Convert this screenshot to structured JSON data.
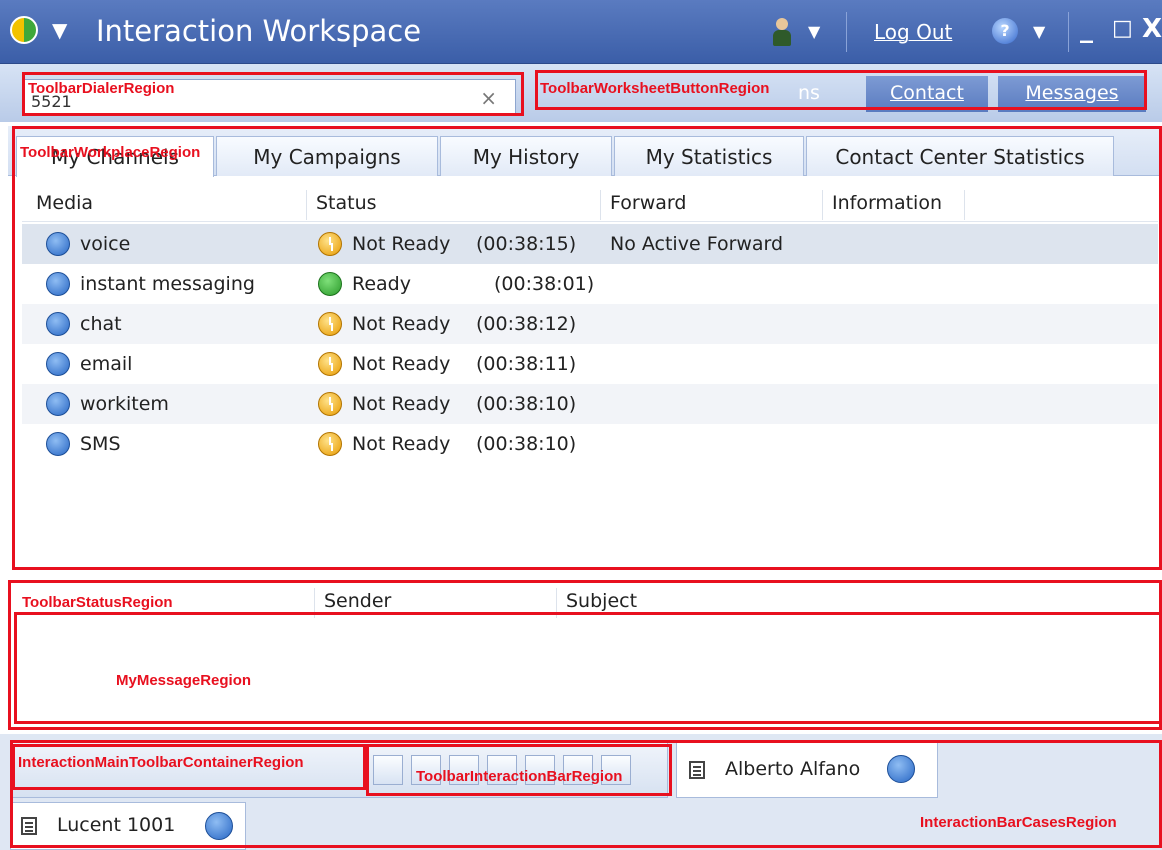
{
  "window": {
    "title": "Interaction Workspace",
    "logout_label": "Log Out",
    "help_glyph": "?",
    "minimize_glyph": "_",
    "maximize_glyph": "□",
    "close_glyph": "X"
  },
  "toolbar": {
    "dialer_value": "5521",
    "clear_glyph": "×",
    "interactions_label": "ns",
    "contact_label": "Contact",
    "messages_label": "Messages"
  },
  "tabs": [
    {
      "label": "My Channels"
    },
    {
      "label": "My Campaigns"
    },
    {
      "label": "My History"
    },
    {
      "label": "My Statistics"
    },
    {
      "label": "Contact Center Statistics"
    }
  ],
  "channels": {
    "columns": [
      "Media",
      "Status",
      "Forward",
      "Information"
    ],
    "rows": [
      {
        "media": "voice",
        "status": "Not Ready",
        "time": "(00:38:15)",
        "forward": "No Active Forward",
        "state": "notready"
      },
      {
        "media": "instant messaging",
        "status": "Ready",
        "time": "(00:38:01)",
        "forward": "",
        "state": "ready"
      },
      {
        "media": "chat",
        "status": "Not Ready",
        "time": "(00:38:12)",
        "forward": "",
        "state": "notready"
      },
      {
        "media": "email",
        "status": "Not Ready",
        "time": "(00:38:11)",
        "forward": "",
        "state": "notready"
      },
      {
        "media": "workitem",
        "status": "Not Ready",
        "time": "(00:38:10)",
        "forward": "",
        "state": "notready"
      },
      {
        "media": "SMS",
        "status": "Not Ready",
        "time": "(00:38:10)",
        "forward": "",
        "state": "notready"
      }
    ]
  },
  "messages": {
    "columns": [
      "Sender",
      "Subject"
    ]
  },
  "cases": [
    {
      "name": "Alberto Alfano"
    },
    {
      "name": "Lucent 1001"
    }
  ],
  "regions": {
    "dialer": "ToolbarDialerRegion",
    "worksheet": "ToolbarWorksheetButtonRegion",
    "workplace": "ToolbarWorkplaceRegion",
    "status": "ToolbarStatusRegion",
    "my_message": "MyMessageRegion",
    "main_toolbar": "InteractionMainToolbarContainerRegion",
    "interaction_bar": "ToolbarInteractionBarRegion",
    "cases": "InteractionBarCasesRegion"
  },
  "colors": {
    "annotation": "#e8101f",
    "titlebar": "#3b5ea8",
    "ready": "#2a9a2a",
    "not_ready": "#e79a00"
  }
}
